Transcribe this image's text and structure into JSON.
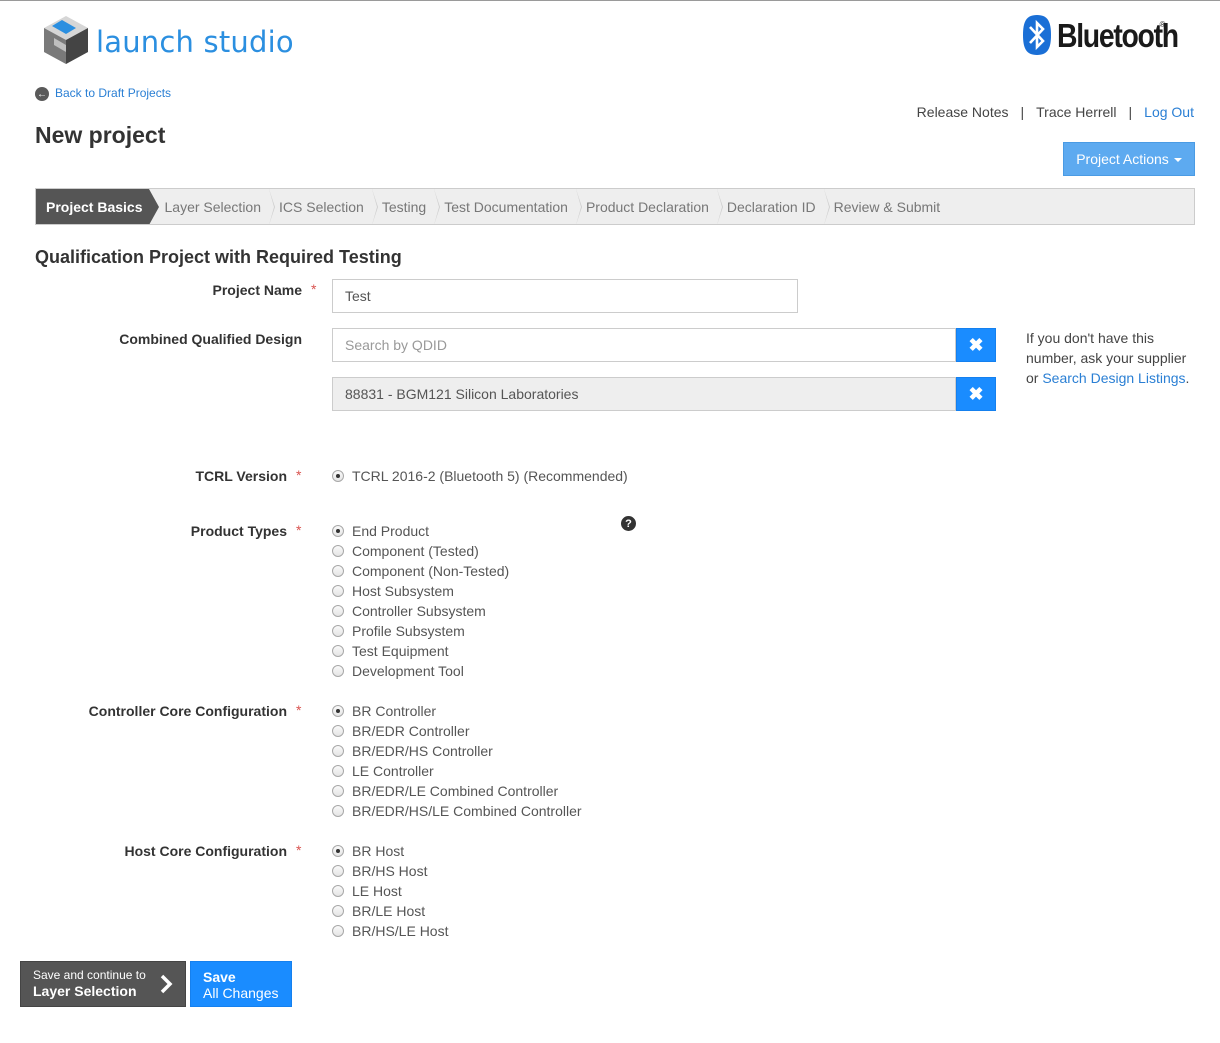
{
  "header": {
    "logo_text": "launch studio",
    "brand_text": "Bluetooth",
    "brand_reg": "®",
    "back_link": "Back to Draft Projects",
    "nav": {
      "release_notes": "Release Notes",
      "user_name": "Trace Herrell",
      "logout": "Log Out",
      "separator": "|"
    },
    "page_title": "New project",
    "project_actions": "Project Actions"
  },
  "steps": [
    {
      "label": "Project Basics",
      "active": true
    },
    {
      "label": "Layer Selection",
      "active": false
    },
    {
      "label": "ICS Selection",
      "active": false
    },
    {
      "label": "Testing",
      "active": false
    },
    {
      "label": "Test Documentation",
      "active": false
    },
    {
      "label": "Product Declaration",
      "active": false
    },
    {
      "label": "Declaration ID",
      "active": false
    },
    {
      "label": "Review & Submit",
      "active": false
    }
  ],
  "form": {
    "section_title": "Qualification Project with Required Testing",
    "required_mark": "*",
    "project_name": {
      "label": "Project Name",
      "value": "Test"
    },
    "cqd": {
      "label": "Combined Qualified Design",
      "search_placeholder": "Search by QDID",
      "selected": "88831 - BGM121 Silicon Laboratories",
      "hint_text": "If you don't have this number, ask your supplier or ",
      "hint_link": "Search Design Listings",
      "hint_end": "."
    },
    "tcrl": {
      "label": "TCRL Version",
      "options": [
        {
          "label": "TCRL 2016-2 (Bluetooth 5) (Recommended)",
          "selected": true
        }
      ]
    },
    "product_types": {
      "label": "Product Types",
      "help": "?",
      "options": [
        {
          "label": "End Product",
          "selected": true
        },
        {
          "label": "Component (Tested)",
          "selected": false
        },
        {
          "label": "Component (Non-Tested)",
          "selected": false
        },
        {
          "label": "Host Subsystem",
          "selected": false
        },
        {
          "label": "Controller Subsystem",
          "selected": false
        },
        {
          "label": "Profile Subsystem",
          "selected": false
        },
        {
          "label": "Test Equipment",
          "selected": false
        },
        {
          "label": "Development Tool",
          "selected": false
        }
      ]
    },
    "controller_core": {
      "label": "Controller Core Configuration",
      "options": [
        {
          "label": "BR Controller",
          "selected": true
        },
        {
          "label": "BR/EDR Controller",
          "selected": false
        },
        {
          "label": "BR/EDR/HS Controller",
          "selected": false
        },
        {
          "label": "LE Controller",
          "selected": false
        },
        {
          "label": "BR/EDR/LE Combined Controller",
          "selected": false
        },
        {
          "label": "BR/EDR/HS/LE Combined Controller",
          "selected": false
        }
      ]
    },
    "host_core": {
      "label": "Host Core Configuration",
      "options": [
        {
          "label": "BR Host",
          "selected": true
        },
        {
          "label": "BR/HS Host",
          "selected": false
        },
        {
          "label": "LE Host",
          "selected": false
        },
        {
          "label": "BR/LE Host",
          "selected": false
        },
        {
          "label": "BR/HS/LE Host",
          "selected": false
        }
      ]
    }
  },
  "footer": {
    "continue_small": "Save and continue to",
    "continue_big": "Layer Selection",
    "save_big": "Save",
    "save_small": "All Changes"
  },
  "colors": {
    "accent": "#1a8cff",
    "link": "#2a7fd4",
    "active_step": "#555555",
    "required": "#d9534f"
  }
}
